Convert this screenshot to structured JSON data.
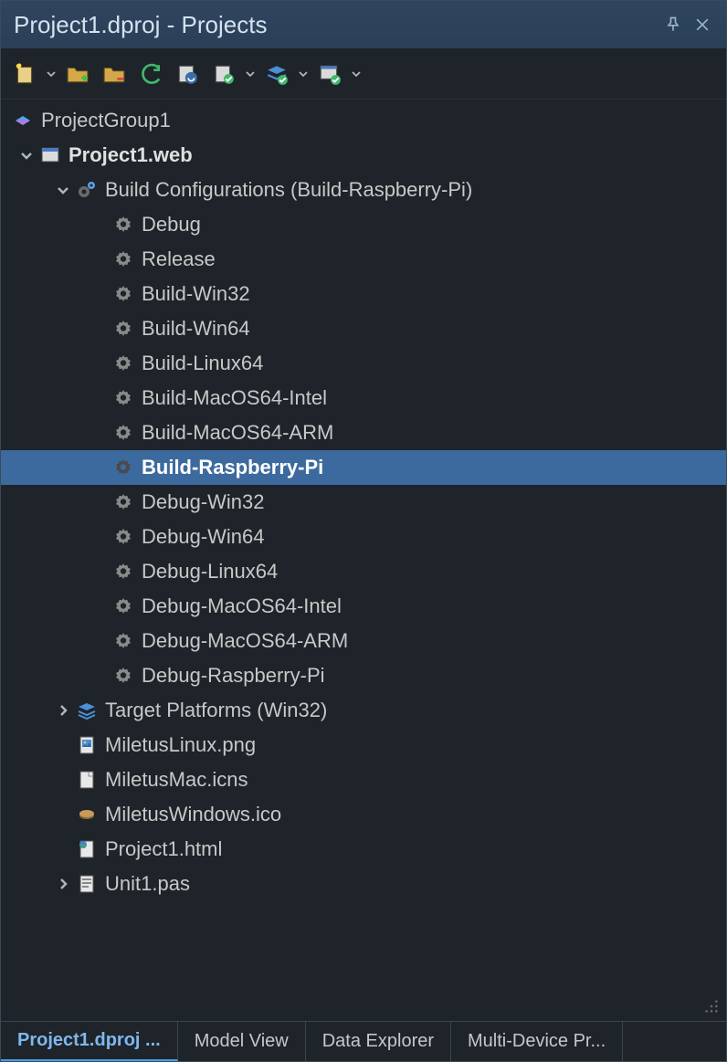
{
  "window": {
    "title": "Project1.dproj - Projects"
  },
  "toolbar": {
    "items": [
      {
        "name": "new-project-icon"
      },
      {
        "name": "open-folder-add-icon"
      },
      {
        "name": "open-folder-remove-icon"
      },
      {
        "name": "refresh-icon"
      },
      {
        "name": "sync-project-icon"
      },
      {
        "name": "configure-icon"
      },
      {
        "name": "layers-check-icon"
      },
      {
        "name": "form-check-icon"
      }
    ]
  },
  "tree": {
    "projectGroup": "ProjectGroup1",
    "project": "Project1.web",
    "buildConfigLabel": "Build Configurations (Build-Raspberry-Pi)",
    "configs": [
      "Debug",
      "Release",
      "Build-Win32",
      "Build-Win64",
      "Build-Linux64",
      "Build-MacOS64-Intel",
      "Build-MacOS64-ARM",
      "Build-Raspberry-Pi",
      "Debug-Win32",
      "Debug-Win64",
      "Debug-Linux64",
      "Debug-MacOS64-Intel",
      "Debug-MacOS64-ARM",
      "Debug-Raspberry-Pi"
    ],
    "selectedConfig": "Build-Raspberry-Pi",
    "targetPlatforms": "Target Platforms (Win32)",
    "files": [
      {
        "label": "MiletusLinux.png",
        "icon": "png"
      },
      {
        "label": "MiletusMac.icns",
        "icon": "file"
      },
      {
        "label": "MiletusWindows.ico",
        "icon": "ico"
      }
    ],
    "projectHtml": "Project1.html",
    "unit": "Unit1.pas"
  },
  "tabs": [
    {
      "label": "Project1.dproj ...",
      "active": true
    },
    {
      "label": "Model View",
      "active": false
    },
    {
      "label": "Data Explorer",
      "active": false
    },
    {
      "label": "Multi-Device Pr...",
      "active": false
    }
  ]
}
